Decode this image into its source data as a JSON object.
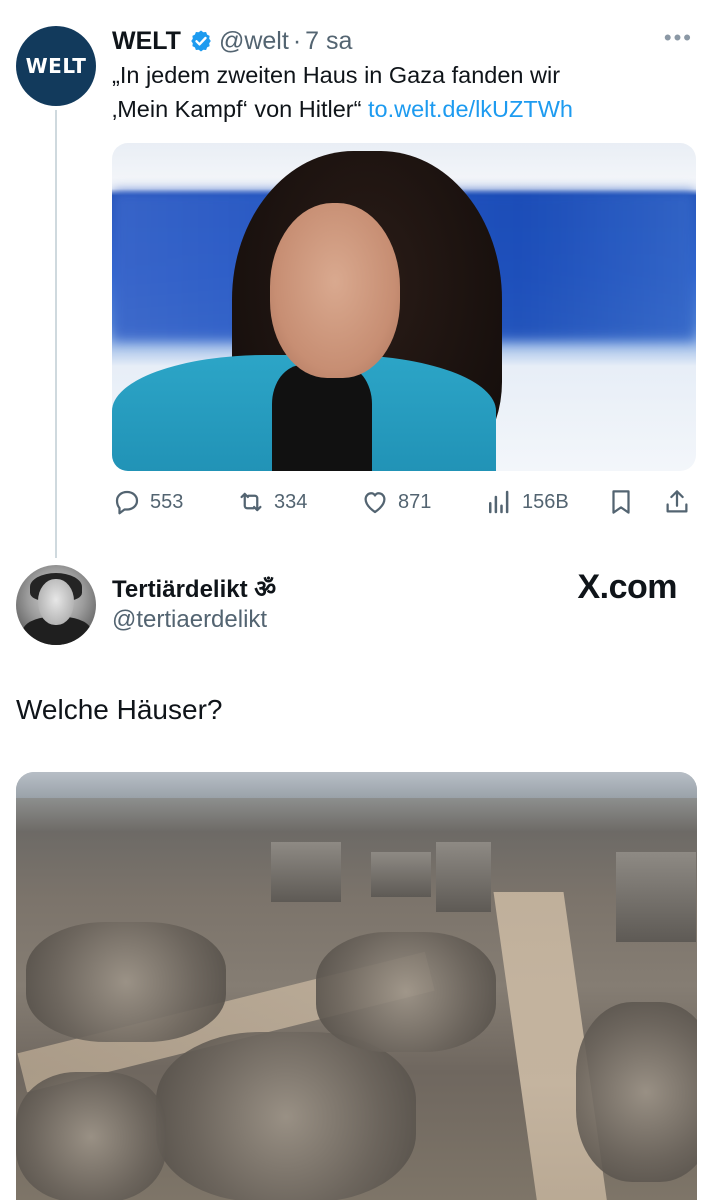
{
  "quoted_tweet": {
    "avatar_text": "WELT",
    "name": "WELT",
    "handle": "@welt",
    "separator": "·",
    "time": "7 sa",
    "more": "•••",
    "text_line1": "„In jedem zweiten Haus in Gaza fanden wir",
    "text_line2": "‚Mein Kampf‘ von Hitler“",
    "link": "to.welt.de/lkUZTWh",
    "stats": {
      "replies": "553",
      "reposts": "334",
      "likes": "871",
      "views": "156B"
    }
  },
  "main_tweet": {
    "name": "Tertiärdelikt ॐ",
    "handle": "@tertiaerdelikt",
    "watermark": "X.com",
    "text": "Welche Häuser?"
  },
  "colors": {
    "link": "#1d9bf0",
    "muted": "#536471",
    "verified": "#1d9bf0",
    "welt_avatar_bg": "#123a5c"
  }
}
